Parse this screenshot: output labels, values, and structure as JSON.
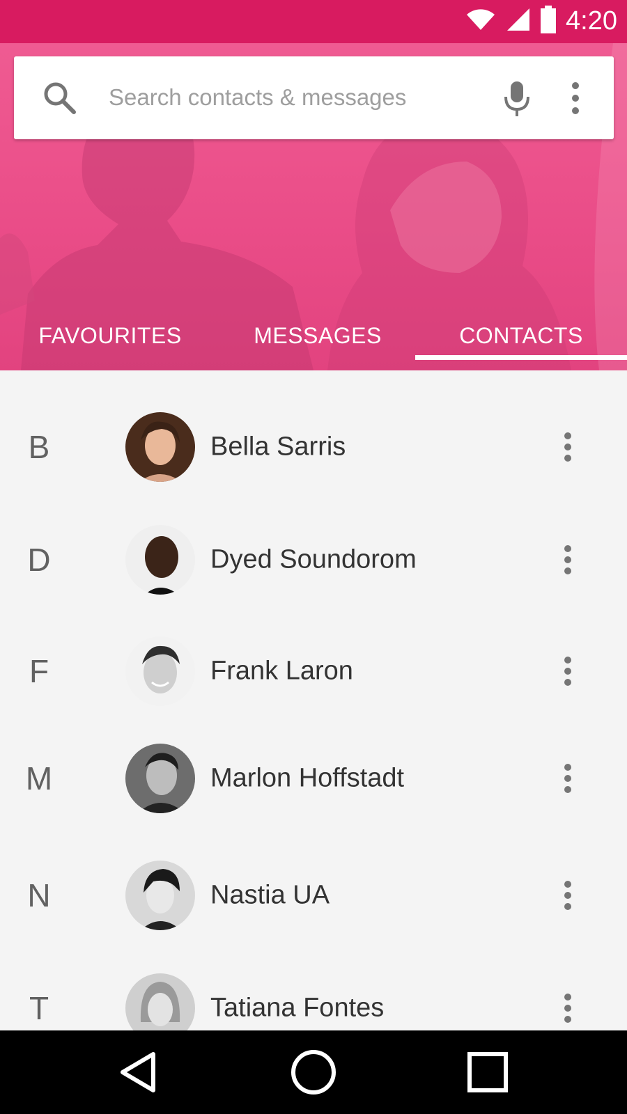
{
  "status_bar": {
    "time": "4:20",
    "icons": [
      "wifi-icon",
      "cell-signal-icon",
      "battery-icon"
    ]
  },
  "search": {
    "placeholder": "Search contacts & messages",
    "value": "",
    "icons": [
      "search-icon",
      "mic-icon",
      "more-vert-icon"
    ]
  },
  "tabs": [
    {
      "label": "FAVOURITES",
      "selected": false
    },
    {
      "label": "MESSAGES",
      "selected": false
    },
    {
      "label": "CONTACTS",
      "selected": true
    }
  ],
  "contacts": [
    {
      "letter": "B",
      "name": "Bella Sarris"
    },
    {
      "letter": "D",
      "name": "Dyed Soundorom"
    },
    {
      "letter": "F",
      "name": "Frank Laron"
    },
    {
      "letter": "M",
      "name": "Marlon Hoffstadt"
    },
    {
      "letter": "N",
      "name": "Nastia UA"
    },
    {
      "letter": "T",
      "name": "Tatiana Fontes"
    }
  ],
  "nav_bar": {
    "icons": [
      "back-icon",
      "home-icon",
      "recents-icon"
    ]
  },
  "colors": {
    "primary_dark": "#d81b60",
    "primary": "#ec5288",
    "list_background": "#f4f4f4"
  }
}
